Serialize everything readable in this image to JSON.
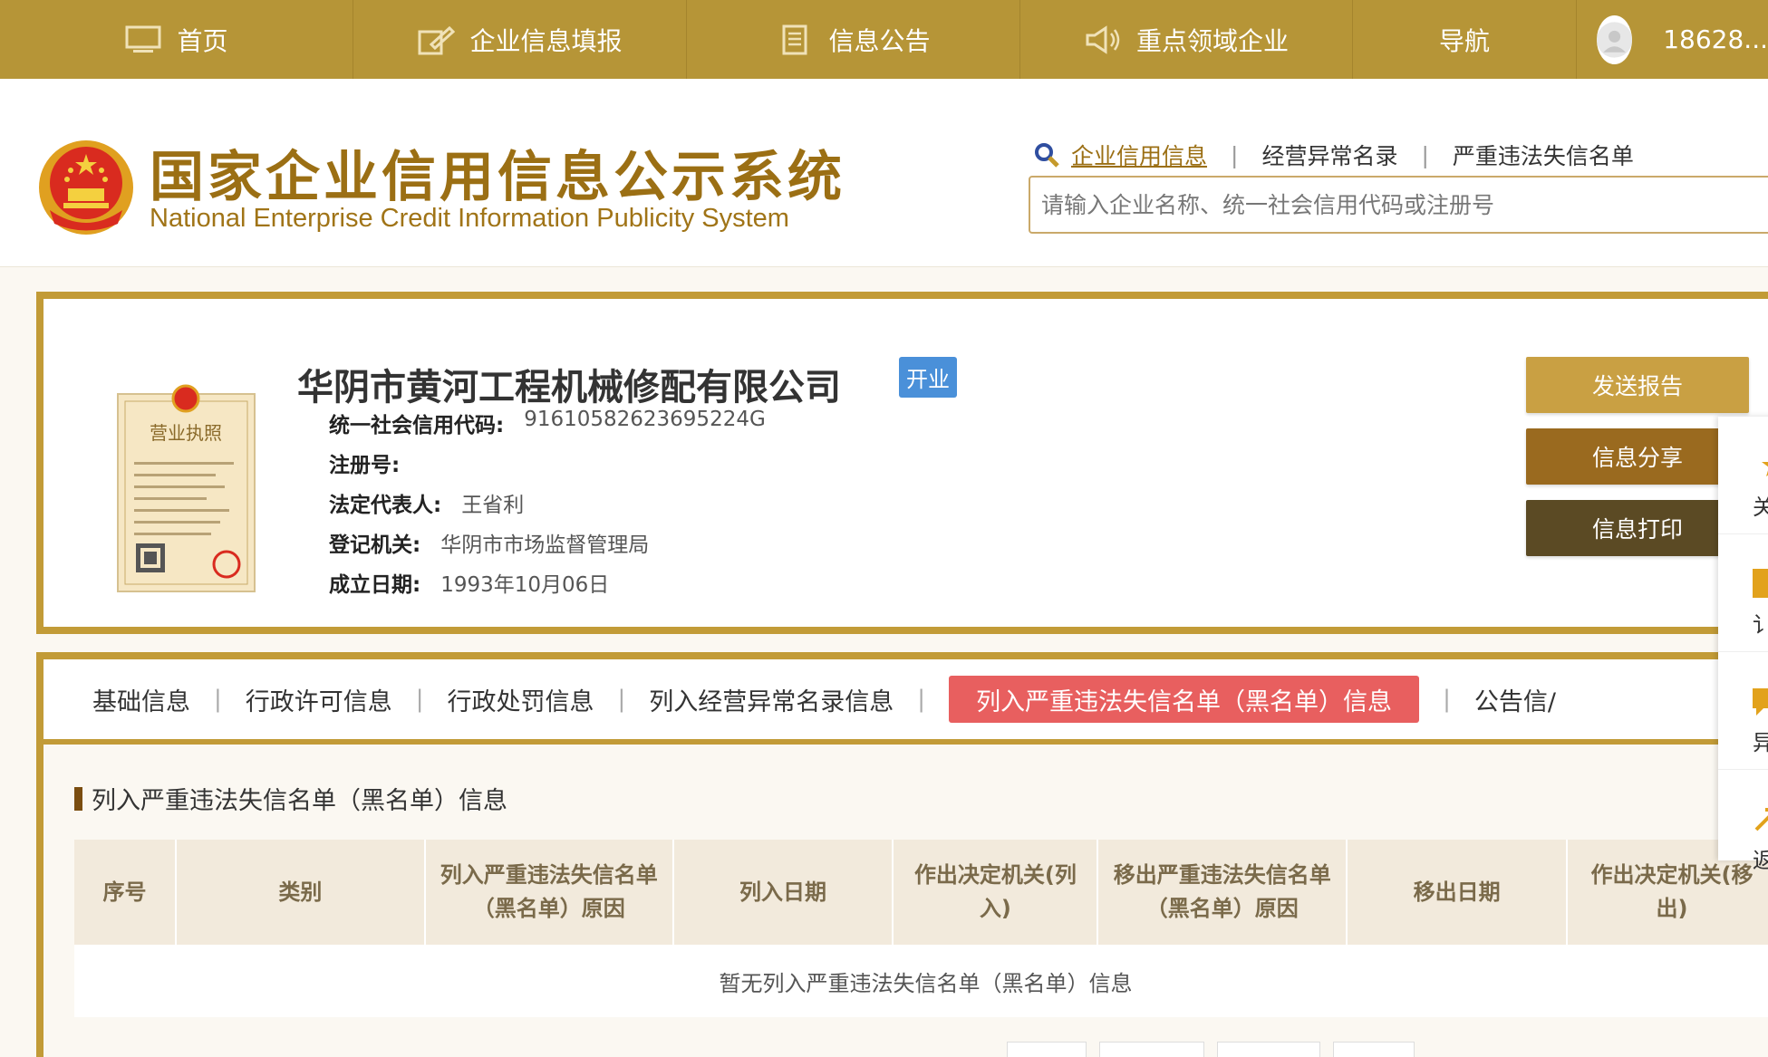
{
  "topnav": {
    "items": [
      {
        "label": "首页",
        "icon": "monitor-icon"
      },
      {
        "label": "企业信息填报",
        "icon": "edit-icon"
      },
      {
        "label": "信息公告",
        "icon": "document-icon"
      },
      {
        "label": "重点领域企业",
        "icon": "megaphone-icon"
      },
      {
        "label": "导航"
      }
    ],
    "user": "18628..."
  },
  "header": {
    "logo_cn": "国家企业信用信息公示系统",
    "logo_en": "National Enterprise Credit Information Publicity System",
    "search_tabs": [
      "企业信用信息",
      "经营异常名录",
      "严重违法失信名单"
    ],
    "search_tab_sep": "|",
    "search_placeholder": "请输入企业名称、统一社会信用代码或注册号"
  },
  "company": {
    "name": "华阴市黄河工程机械修配有限公司",
    "status": "开业",
    "fields": [
      {
        "label": "统一社会信用代码:",
        "value": "91610582623695224G"
      },
      {
        "label": "注册号:",
        "value": ""
      },
      {
        "label": "法定代表人:",
        "value": "王省利"
      },
      {
        "label": "登记机关:",
        "value": "华阴市市场监督管理局"
      },
      {
        "label": "成立日期:",
        "value": "1993年10月06日"
      }
    ],
    "license_title": "营业执照",
    "actions": [
      "发送报告",
      "信息分享",
      "信息打印"
    ]
  },
  "side_panel": {
    "items": [
      "关",
      "讠",
      "异",
      "返"
    ]
  },
  "tabs": {
    "items": [
      "基础信息",
      "行政许可信息",
      "行政处罚信息",
      "列入经营异常名录信息",
      "列入严重违法失信名单（黑名单）信息",
      "公告信/"
    ],
    "sep": "|",
    "active_index": 4
  },
  "blacklist": {
    "title": "列入严重违法失信名单（黑名单）信息",
    "columns": [
      "序号",
      "类别",
      "列入严重违法失信名单（黑名单）原因",
      "列入日期",
      "作出决定机关(列入)",
      "移出严重违法失信名单（黑名单）原因",
      "移出日期",
      "作出决定机关(移出)"
    ],
    "empty_text": "暂无列入严重违法失信名单（黑名单）信息"
  },
  "colors": {
    "nav_bg": "#b69537",
    "accent_gold": "#c29b37",
    "active_tab": "#e85f5f",
    "status_blue": "#4a90d9"
  }
}
